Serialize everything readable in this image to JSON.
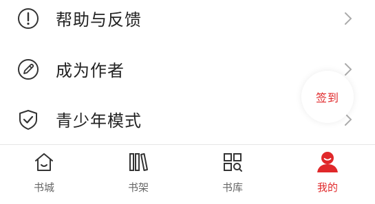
{
  "menu": {
    "items": [
      {
        "label": "帮助与反馈",
        "icon": "alert-circle-icon"
      },
      {
        "label": "成为作者",
        "icon": "pen-circle-icon"
      },
      {
        "label": "青少年模式",
        "icon": "shield-check-icon"
      }
    ]
  },
  "checkin": {
    "label": "签到"
  },
  "tabbar": {
    "tabs": [
      {
        "label": "书城",
        "icon": "home-icon",
        "active": false
      },
      {
        "label": "书架",
        "icon": "bookshelf-icon",
        "active": false
      },
      {
        "label": "书库",
        "icon": "library-grid-icon",
        "active": false
      },
      {
        "label": "我的",
        "icon": "user-icon",
        "active": true
      }
    ]
  },
  "colors": {
    "accent": "#e0282a",
    "text": "#222222",
    "muted": "#666666",
    "icon": "#333333",
    "chevron": "#aaaaaa",
    "divider": "#e6e6e6"
  }
}
